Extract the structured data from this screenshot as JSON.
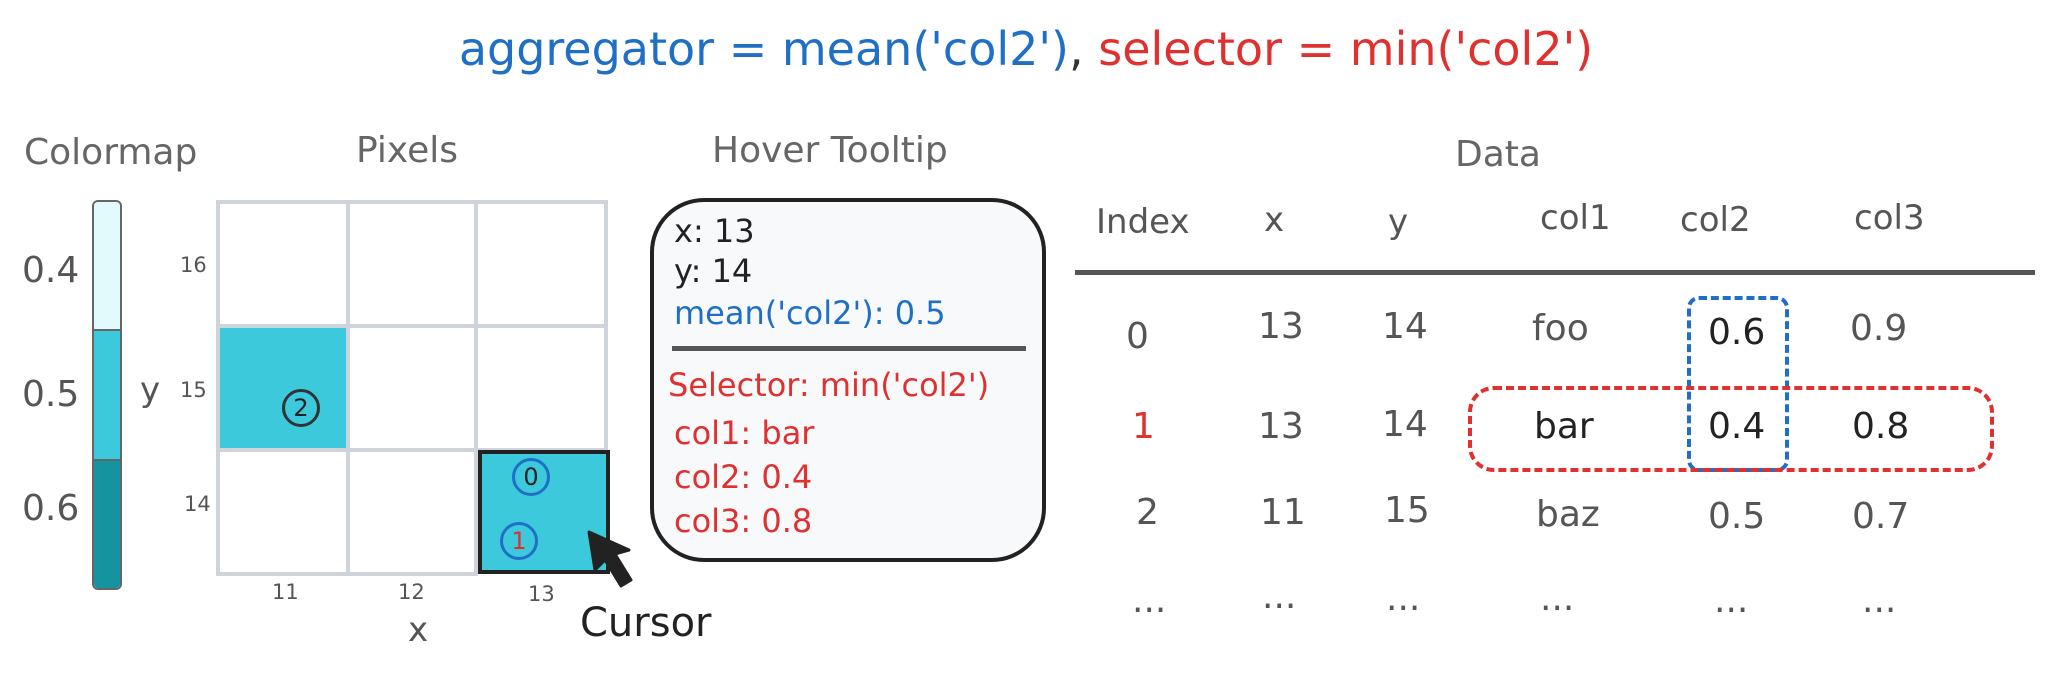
{
  "title": {
    "aggregator": "aggregator = mean('col2')",
    "separator": ",",
    "selector": "selector = min('col2')"
  },
  "colors": {
    "aggregator": "#1f6fc6",
    "selector": "#e03131",
    "pixel_fill": "#3bc9db",
    "grid": "#ced4da"
  },
  "colormap": {
    "heading": "Colormap",
    "ticks": [
      "0.4",
      "0.5",
      "0.6"
    ]
  },
  "pixels": {
    "heading": "Pixels",
    "x_label": "x",
    "y_label": "y",
    "x_ticks": [
      "11",
      "12",
      "13"
    ],
    "y_ticks": [
      "16",
      "15",
      "14"
    ],
    "markers": [
      "2",
      "0",
      "1"
    ],
    "cursor_label": "Cursor"
  },
  "tooltip": {
    "heading": "Hover Tooltip",
    "x": "x: 13",
    "y": "y: 14",
    "aggregate": "mean('col2'): 0.5",
    "selector": "Selector: min('col2')",
    "col1": "col1: bar",
    "col2": "col2: 0.4",
    "col3": "col3: 0.8"
  },
  "table": {
    "heading": "Data",
    "columns": [
      "Index",
      "x",
      "y",
      "col1",
      "col2",
      "col3"
    ],
    "rows": [
      [
        "0",
        "13",
        "14",
        "foo",
        "0.6",
        "0.9"
      ],
      [
        "1",
        "13",
        "14",
        "bar",
        "0.4",
        "0.8"
      ],
      [
        "2",
        "11",
        "15",
        "baz",
        "0.5",
        "0.7"
      ],
      [
        "...",
        "...",
        "...",
        "...",
        "...",
        "..."
      ]
    ]
  }
}
